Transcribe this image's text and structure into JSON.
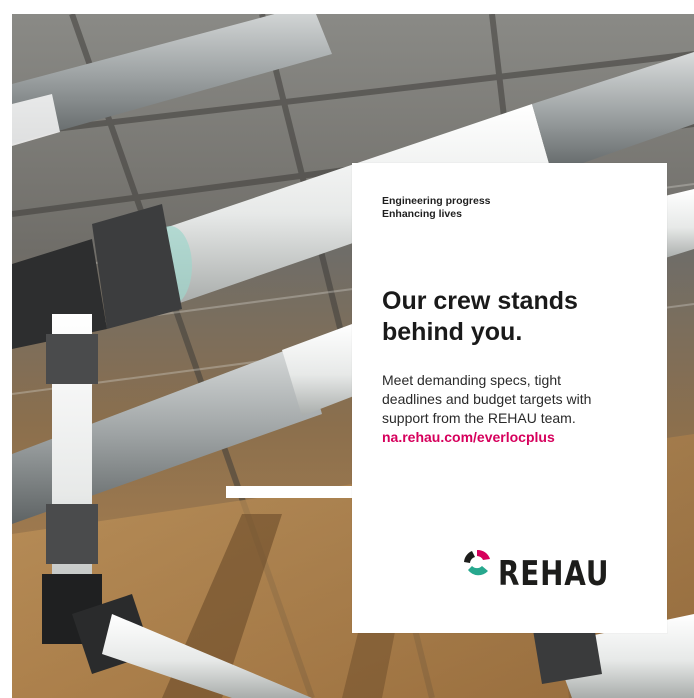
{
  "ad": {
    "tagline": [
      "Engineering progress",
      "Enhancing lives"
    ],
    "headline": [
      "Our crew stands",
      "behind you."
    ],
    "body": [
      "Meet demanding specs, tight",
      "deadlines and budget targets with",
      "support from the REHAU team."
    ],
    "url": "na.rehau.com/everlocplus"
  },
  "brand": {
    "name": "REHAU",
    "logo_icon": "rehau-logo-mark-icon",
    "accent_color": "#d6005c",
    "logo_colors": [
      "#d6005c",
      "#27a88e",
      "#1d1d1b"
    ]
  },
  "background": {
    "description_icon": "pipes-photo-icon"
  }
}
